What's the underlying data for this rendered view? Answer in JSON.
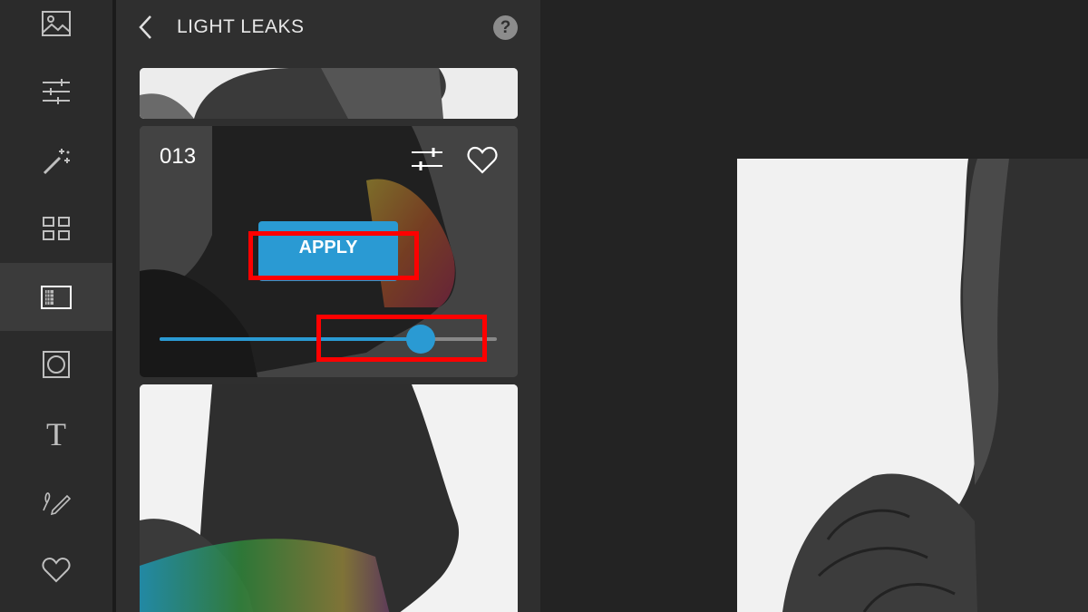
{
  "sidebar": {
    "items": [
      {
        "icon": "image-icon",
        "active": false
      },
      {
        "icon": "sliders-icon",
        "active": false
      },
      {
        "icon": "magic-wand-icon",
        "active": false
      },
      {
        "icon": "grid-icon",
        "active": false
      },
      {
        "icon": "overlay-frame-icon",
        "active": true
      },
      {
        "icon": "vignette-frame-icon",
        "active": false
      },
      {
        "icon": "text-icon",
        "active": false
      },
      {
        "icon": "draw-icon",
        "active": false
      },
      {
        "icon": "heart-icon",
        "active": false
      }
    ],
    "text_glyph": "T"
  },
  "panel": {
    "title": "LIGHT LEAKS",
    "help_label": "?",
    "active_card": {
      "number": "013",
      "apply_label": "APPLY",
      "slider_value": 0.775
    }
  },
  "colors": {
    "accent": "#2a9ad3",
    "highlight": "#ff0000"
  }
}
